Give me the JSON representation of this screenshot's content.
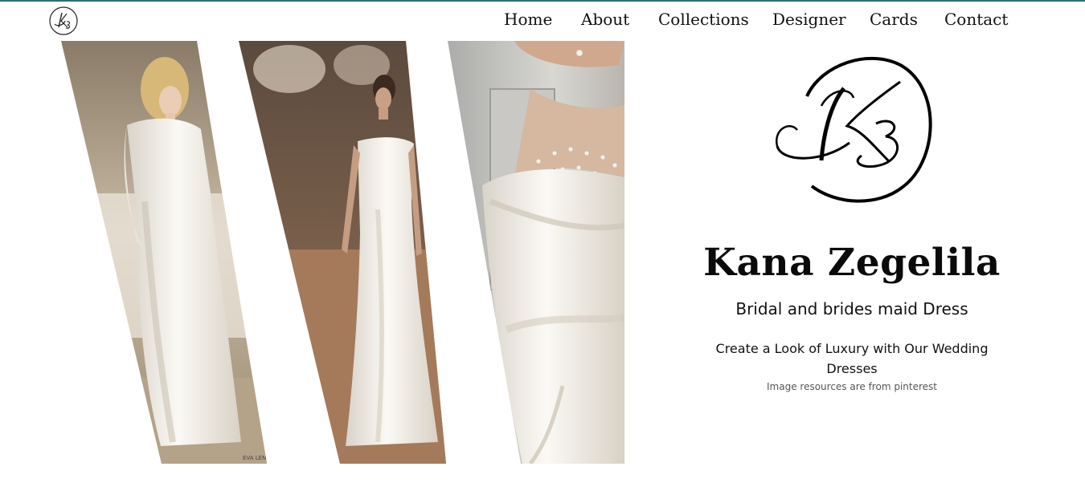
{
  "header": {
    "logo_icon": "k3-monogram-icon",
    "nav": [
      {
        "label": "Home"
      },
      {
        "label": "About"
      },
      {
        "label": "Collections"
      },
      {
        "label": "Designer"
      },
      {
        "label": "Cards"
      },
      {
        "label": "Contact"
      }
    ]
  },
  "gallery": {
    "panels": [
      {
        "alt": "Bride in long-sleeve lace mermaid gown",
        "watermark": "EVA LENDEL"
      },
      {
        "alt": "Bride in strapless satin draped gown"
      },
      {
        "alt": "Close-up of pearl-embellished off-shoulder satin gown"
      }
    ]
  },
  "hero": {
    "logo_icon": "k3-monogram-icon",
    "title": "Kana Zegelila",
    "subtitle": "Bridal and brides maid Dress",
    "description": "Create a Look of Luxury with Our Wedding Dresses",
    "note": "Image resources are from pinterest"
  },
  "colors": {
    "accent_line": "#2f6f73",
    "text": "#111111",
    "muted": "#555555"
  }
}
